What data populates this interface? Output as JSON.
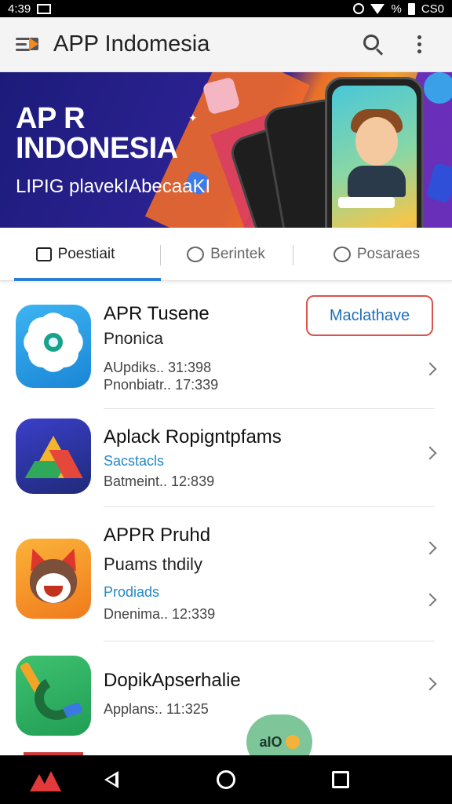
{
  "status_bar": {
    "time": "4:39",
    "right_text": "%",
    "right_text2": "CS0"
  },
  "app_bar": {
    "title": "APP Indomesia"
  },
  "banner": {
    "title_line1": "AP R",
    "title_line2": "INDONESIA",
    "subtitle": "LIPIG plavekIAbecaaKI"
  },
  "tabs": [
    {
      "label": "Poestiait",
      "icon": "note-icon",
      "active": true
    },
    {
      "label": "Berintek",
      "icon": "chat-icon",
      "active": false
    },
    {
      "label": "Posaraes",
      "icon": "chat-icon",
      "active": false
    }
  ],
  "apps": [
    {
      "title": "APR Tusene",
      "lines": [
        "Pnonica",
        "AUpdiks.. 31:398",
        "Pnonbiatr.. 17:339"
      ],
      "action_label": "Maclathave"
    },
    {
      "title": "Aplack Ropigntpfams",
      "lines": [
        "Sacstacls",
        "Batmeint.. 12:839"
      ]
    },
    {
      "title": "APPR Pruhd",
      "lines": [
        "Puams thdily",
        "Prodiads",
        "Dnenima.. 12:339"
      ]
    },
    {
      "title": "DopikApserhalie",
      "lines": [
        "Applans:. 11:325"
      ]
    }
  ],
  "fab": {
    "label": "aIO"
  },
  "colors": {
    "accent": "#2189c6",
    "tab_indicator": "#2a7fd0",
    "button_border": "#d9534f"
  }
}
